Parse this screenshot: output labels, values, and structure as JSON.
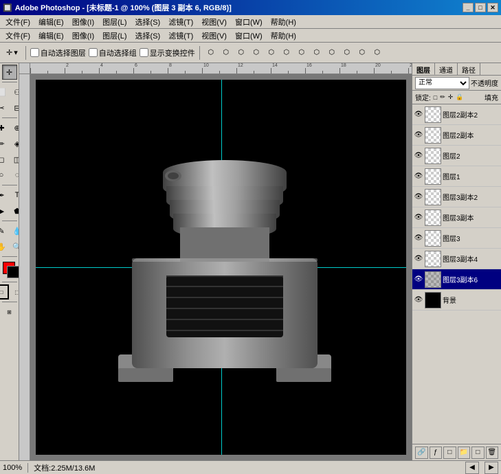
{
  "titlebar": {
    "title": "Adobe Photoshop - [未标题-1 @ 100% (图层 3 副本 6, RGB/8)]",
    "app": "Adobe Photoshop"
  },
  "menubar": {
    "items": [
      "文件(F)",
      "编辑(E)",
      "图像(I)",
      "图层(L)",
      "选择(S)",
      "滤镜(T)",
      "视图(V)",
      "窗口(W)",
      "帮助(H)"
    ]
  },
  "menubar2": {
    "items": [
      "文件(F)",
      "编辑(E)",
      "图像(I)",
      "图层(L)",
      "选择(S)",
      "滤镜(T)",
      "视图(V)",
      "窗口(W)",
      "帮助(H)"
    ]
  },
  "toolbar": {
    "auto_select_layer": "自动选择图层",
    "auto_select_group": "自动选择组",
    "show_transform": "显示变换控件"
  },
  "panel": {
    "tabs": [
      "图层",
      "通道",
      "路径"
    ],
    "blend_mode": "正常",
    "opacity_label": "不透明度",
    "lock_label": "锁定:",
    "fill_label": "填充",
    "layers": [
      {
        "name": "图层2副本2",
        "visible": true,
        "selected": false,
        "thumb": "checker"
      },
      {
        "name": "图层2副本",
        "visible": true,
        "selected": false,
        "thumb": "checker"
      },
      {
        "name": "图层2",
        "visible": true,
        "selected": false,
        "thumb": "checker"
      },
      {
        "name": "图层1",
        "visible": true,
        "selected": false,
        "thumb": "checker"
      },
      {
        "name": "图层3副本2",
        "visible": true,
        "selected": false,
        "thumb": "checker"
      },
      {
        "name": "图层3副本",
        "visible": true,
        "selected": false,
        "thumb": "checker"
      },
      {
        "name": "图层3",
        "visible": true,
        "selected": false,
        "thumb": "checker"
      },
      {
        "name": "图层3副本4",
        "visible": true,
        "selected": false,
        "thumb": "checker"
      },
      {
        "name": "图层3副本6",
        "visible": true,
        "selected": true,
        "thumb": "checker"
      },
      {
        "name": "背景",
        "visible": true,
        "selected": false,
        "thumb": "black"
      }
    ]
  },
  "status": {
    "zoom": "100%",
    "doc_size": "文档:2.25M/13.6M"
  }
}
